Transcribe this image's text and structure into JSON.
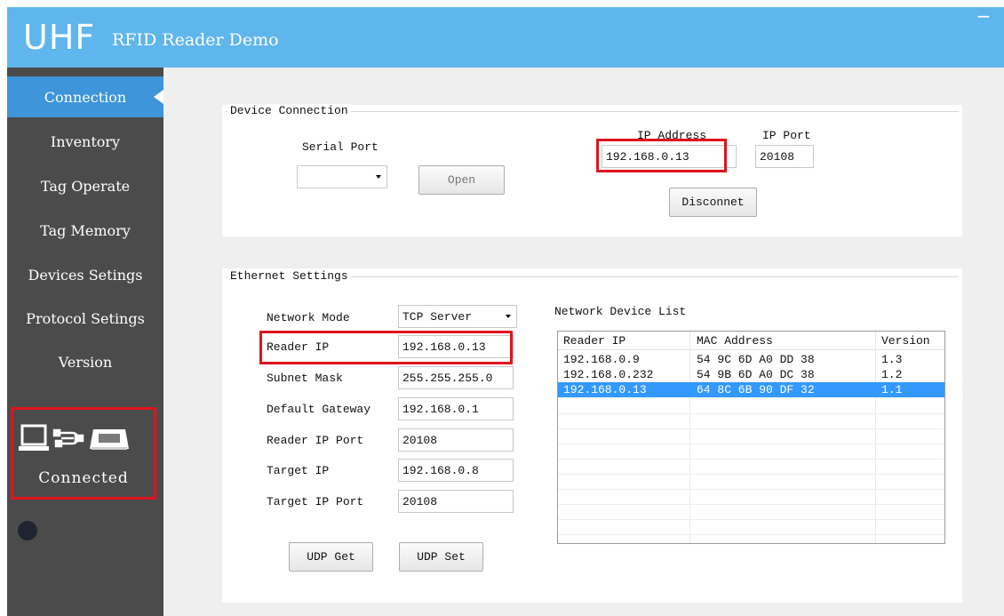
{
  "window": {
    "title_big": "UHF",
    "title_small": "RFID Reader Demo",
    "minimize_glyph": "−"
  },
  "sidebar": {
    "items": [
      {
        "label": "Connection",
        "active": true
      },
      {
        "label": "Inventory",
        "active": false
      },
      {
        "label": "Tag Operate",
        "active": false
      },
      {
        "label": "Tag Memory",
        "active": false
      },
      {
        "label": "Devices Setings",
        "active": false
      },
      {
        "label": "Protocol Setings",
        "active": false
      },
      {
        "label": "Version",
        "active": false
      }
    ],
    "status": {
      "label": "Connected",
      "icons": [
        "laptop-icon",
        "cable-icon",
        "reader-device-icon"
      ]
    }
  },
  "device_connection": {
    "legend": "Device Connection",
    "serial_port_label": "Serial Port",
    "serial_port_value": "",
    "open_button": "Open",
    "ip_address_label": "IP Address",
    "ip_address_value": "192.168.0.13",
    "ip_port_label": "IP Port",
    "ip_port_value": "20108",
    "disconnect_button": "Disconnet"
  },
  "ethernet_settings": {
    "legend": "Ethernet Settings",
    "fields": [
      {
        "label": "Network Mode",
        "value": "TCP Server",
        "type": "select"
      },
      {
        "label": "Reader IP",
        "value": "192.168.0.13",
        "type": "input"
      },
      {
        "label": "Subnet Mask",
        "value": "255.255.255.0",
        "type": "input"
      },
      {
        "label": "Default Gateway",
        "value": "192.168.0.1",
        "type": "input"
      },
      {
        "label": "Reader IP Port",
        "value": "20108",
        "type": "input"
      },
      {
        "label": "Target IP",
        "value": "192.168.0.8",
        "type": "input"
      },
      {
        "label": "Target IP Port",
        "value": "20108",
        "type": "input"
      }
    ],
    "udp_get_button": "UDP Get",
    "udp_set_button": "UDP Set",
    "device_list": {
      "title": "Network Device List",
      "columns": [
        "Reader IP",
        "MAC Address",
        "Version"
      ],
      "rows": [
        {
          "reader_ip": "192.168.0.9",
          "mac": "54 9C 6D A0 DD 38",
          "version": "1.3",
          "selected": false
        },
        {
          "reader_ip": "192.168.0.232",
          "mac": "54 9B 6D A0 DC 38",
          "version": "1.2",
          "selected": false
        },
        {
          "reader_ip": "192.168.0.13",
          "mac": "64 8C 6B 90 DF 32",
          "version": "1.1",
          "selected": true
        }
      ]
    }
  },
  "colors": {
    "titlebar": "#5fb6ec",
    "sidebar": "#4b4b4b",
    "active_nav": "#3e95d9",
    "highlight_box": "#e0141e",
    "selected_row": "#3399ff"
  }
}
